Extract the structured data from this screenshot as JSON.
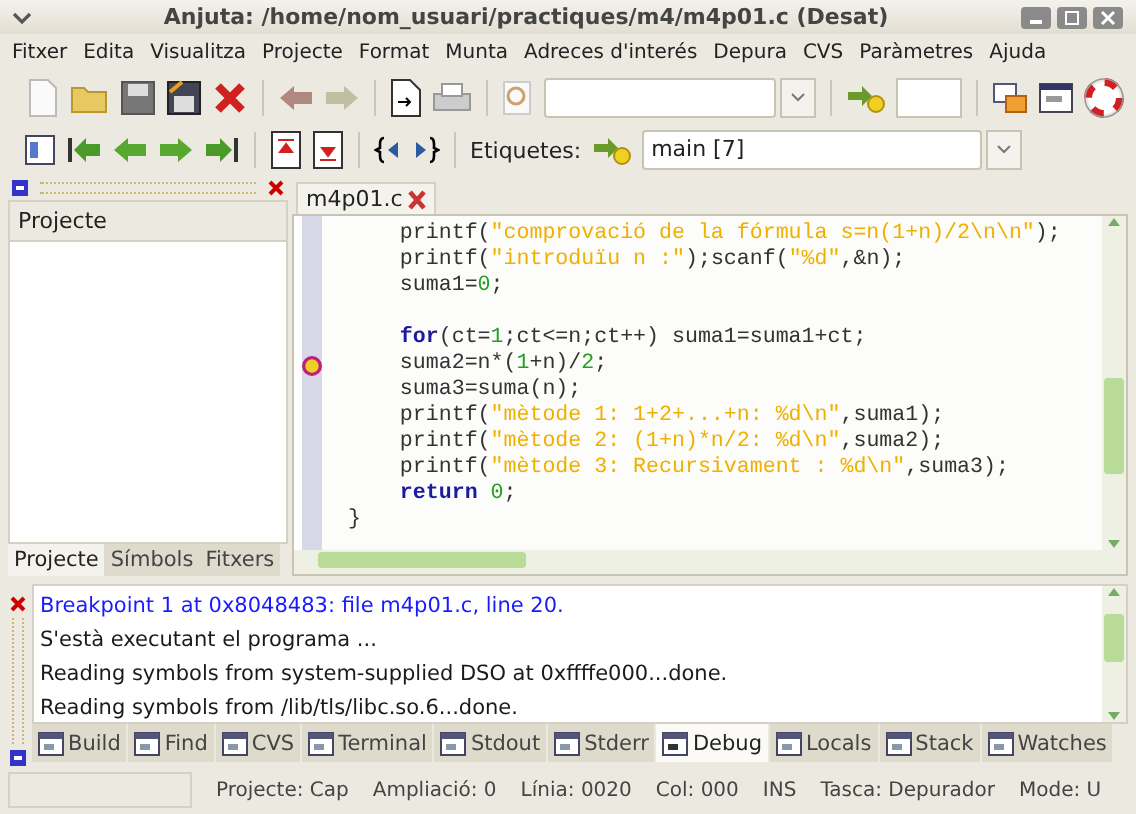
{
  "window": {
    "title": "Anjuta: /home/nom_usuari/practiques/m4/m4p01.c (Desat)"
  },
  "menu": [
    "Fitxer",
    "Edita",
    "Visualitza",
    "Projecte",
    "Format",
    "Munta",
    "Adreces d'interés",
    "Depura",
    "CVS",
    "Paràmetres",
    "Ajuda"
  ],
  "toolbar2": {
    "label": "Etiquetes:",
    "combo_value": "main [7]"
  },
  "left_panel": {
    "title": "Projecte",
    "tabs": [
      {
        "label": "Projecte",
        "selected": true
      },
      {
        "label": "Símbols",
        "selected": false
      },
      {
        "label": "Fitxers",
        "selected": false
      }
    ]
  },
  "editor": {
    "tab": "m4p01.c",
    "lines": [
      {
        "breakpoint": false,
        "tokens": [
          {
            "kind": "plain",
            "text": "    printf("
          },
          {
            "kind": "string",
            "text": "\"comprovació de la fórmula s=n(1+n)/2\\n\\n\""
          },
          {
            "kind": "plain",
            "text": ");"
          }
        ]
      },
      {
        "breakpoint": false,
        "tokens": [
          {
            "kind": "plain",
            "text": "    printf("
          },
          {
            "kind": "string",
            "text": "\"introduïu n :\""
          },
          {
            "kind": "plain",
            "text": ");scanf("
          },
          {
            "kind": "string",
            "text": "\"%d\""
          },
          {
            "kind": "plain",
            "text": ",&n);"
          }
        ]
      },
      {
        "breakpoint": false,
        "tokens": [
          {
            "kind": "plain",
            "text": "    suma1="
          },
          {
            "kind": "number",
            "text": "0"
          },
          {
            "kind": "plain",
            "text": ";"
          }
        ]
      },
      {
        "kind": "blank"
      },
      {
        "breakpoint": false,
        "tokens": [
          {
            "kind": "keyword",
            "text": "    for"
          },
          {
            "kind": "plain",
            "text": "(ct="
          },
          {
            "kind": "number",
            "text": "1"
          },
          {
            "kind": "plain",
            "text": ";ct<=n;ct++) suma1=suma1+ct;"
          }
        ]
      },
      {
        "breakpoint": true,
        "tokens": [
          {
            "kind": "plain",
            "text": "    suma2=n*("
          },
          {
            "kind": "number",
            "text": "1"
          },
          {
            "kind": "plain",
            "text": "+n)/"
          },
          {
            "kind": "number",
            "text": "2"
          },
          {
            "kind": "plain",
            "text": ";"
          }
        ]
      },
      {
        "breakpoint": false,
        "tokens": [
          {
            "kind": "plain",
            "text": "    suma3=suma(n);"
          }
        ]
      },
      {
        "breakpoint": false,
        "tokens": [
          {
            "kind": "plain",
            "text": "    printf("
          },
          {
            "kind": "string",
            "text": "\"mètode 1: 1+2+...+n: %d\\n\""
          },
          {
            "kind": "plain",
            "text": ",suma1);"
          }
        ]
      },
      {
        "breakpoint": false,
        "tokens": [
          {
            "kind": "plain",
            "text": "    printf("
          },
          {
            "kind": "string",
            "text": "\"mètode 2: (1+n)*n/2: %d\\n\""
          },
          {
            "kind": "plain",
            "text": ",suma2);"
          }
        ]
      },
      {
        "breakpoint": false,
        "tokens": [
          {
            "kind": "plain",
            "text": "    printf("
          },
          {
            "kind": "string",
            "text": "\"mètode 3: Recursivament : %d\\n\""
          },
          {
            "kind": "plain",
            "text": ",suma3);"
          }
        ]
      },
      {
        "breakpoint": false,
        "tokens": [
          {
            "kind": "keyword",
            "text": "    return "
          },
          {
            "kind": "number",
            "text": "0"
          },
          {
            "kind": "plain",
            "text": ";"
          }
        ]
      },
      {
        "breakpoint": false,
        "tokens": [
          {
            "kind": "plain",
            "text": "}"
          }
        ]
      }
    ]
  },
  "messages": [
    {
      "text": "Breakpoint 1 at 0x8048483: file m4p01.c, line 20.",
      "color": "#1a1aff"
    },
    {
      "text": "S'està executant el programa ...",
      "color": "#1a1a1a"
    },
    {
      "text": "Reading symbols from system-supplied DSO at 0xffffe000...done.",
      "color": "#1a1a1a"
    },
    {
      "text": "Reading symbols from /lib/tls/libc.so.6...done.",
      "color": "#1a1a1a"
    }
  ],
  "bottom_tabs": [
    {
      "label": "Build",
      "selected": false
    },
    {
      "label": "Find",
      "selected": false
    },
    {
      "label": "CVS",
      "selected": false
    },
    {
      "label": "Terminal",
      "selected": false
    },
    {
      "label": "Stdout",
      "selected": false
    },
    {
      "label": "Stderr",
      "selected": false
    },
    {
      "label": "Debug",
      "selected": true
    },
    {
      "label": "Locals",
      "selected": false
    },
    {
      "label": "Stack",
      "selected": false
    },
    {
      "label": "Watches",
      "selected": false
    }
  ],
  "status_bar": [
    "Projecte: Cap",
    "Ampliació: 0",
    "Línia: 0020",
    "Col: 000",
    "INS",
    "Tasca: Depurador",
    "Mode: U"
  ]
}
